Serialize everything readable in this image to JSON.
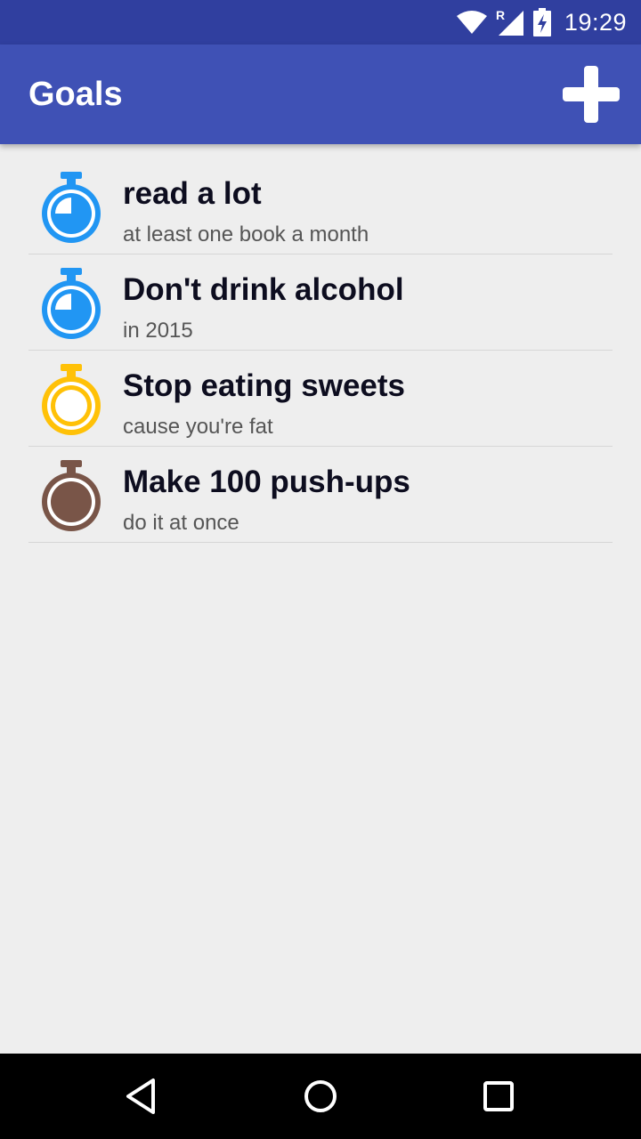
{
  "status_bar": {
    "time": "19:29",
    "roaming_indicator": "R",
    "icons": [
      "wifi-icon",
      "signal-icon",
      "battery-charging-icon"
    ]
  },
  "app_bar": {
    "title": "Goals",
    "add_icon": "plus-icon"
  },
  "goals": [
    {
      "title": "read a lot",
      "subtitle": "at least one book a month",
      "icon": "stopwatch-icon",
      "color": "#2196f3",
      "style": "progress"
    },
    {
      "title": "Don't drink alcohol",
      "subtitle": "in 2015",
      "icon": "stopwatch-icon",
      "color": "#2196f3",
      "style": "progress"
    },
    {
      "title": "Stop eating sweets",
      "subtitle": "cause you're fat",
      "icon": "stopwatch-icon",
      "color": "#ffc107",
      "style": "ring"
    },
    {
      "title": "Make 100 push-ups",
      "subtitle": "do it at once",
      "icon": "stopwatch-icon",
      "color": "#795548",
      "style": "filled"
    }
  ],
  "nav_bar": {
    "buttons": [
      "back-icon",
      "home-icon",
      "recents-icon"
    ]
  },
  "colors": {
    "primary": "#3f51b5",
    "primary_dark": "#303f9f",
    "background": "#eeeeee"
  }
}
